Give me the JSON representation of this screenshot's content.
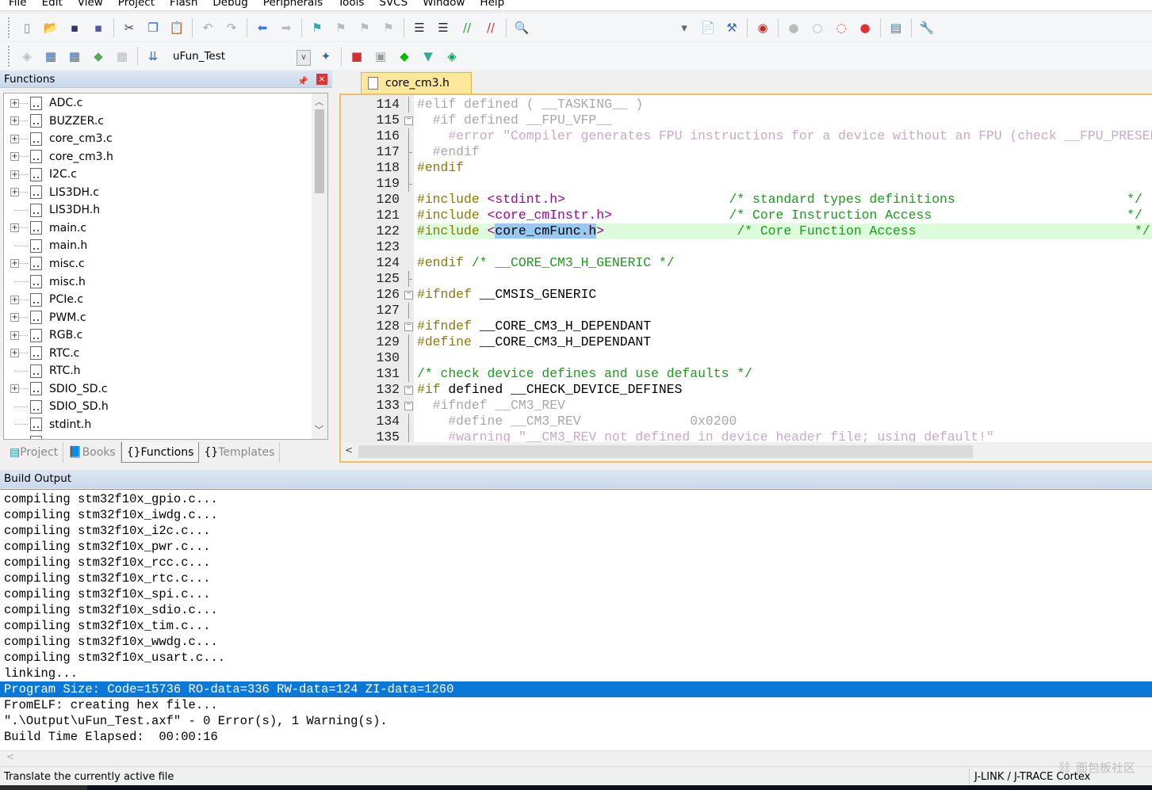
{
  "menu": [
    "File",
    "Edit",
    "View",
    "Project",
    "Flash",
    "Debug",
    "Peripherals",
    "Tools",
    "SVCS",
    "Window",
    "Help"
  ],
  "toolbar1": [
    "new-file",
    "open-file",
    "save",
    "save-all",
    "|",
    "cut",
    "copy",
    "paste",
    "|",
    "undo",
    "redo",
    "|",
    "navigate-back",
    "navigate-forward",
    "|",
    "bookmark",
    "prev-bookmark",
    "next-bookmark",
    "clear-bookmarks",
    "|",
    "indent",
    "unindent",
    "comment",
    "uncomment",
    "|",
    "find-in-files"
  ],
  "toolbar1_right": [
    "find-dropdown",
    "incremental-find",
    "find-references",
    "|",
    "debug-session",
    "|",
    "breakpoint",
    "breakpoint-disabled",
    "disable-all-breakpoints",
    "kill-all-breakpoints",
    "|",
    "window-layout",
    "|",
    "configure"
  ],
  "toolbar2": [
    "translate",
    "build",
    "rebuild",
    "batch-build",
    "stop-build",
    "|",
    "download"
  ],
  "target": "uFun_Test",
  "toolbar2_right": [
    "target-options",
    "|",
    "manage-components",
    "select-packs",
    "pack-installer",
    "event-recorder",
    "run-time-environment"
  ],
  "left_panel": {
    "title": "Functions",
    "pin": "pin-icon",
    "close": "×",
    "items": [
      {
        "label": "ADC.c",
        "expand": true
      },
      {
        "label": "BUZZER.c",
        "expand": true
      },
      {
        "label": "core_cm3.c",
        "expand": true
      },
      {
        "label": "core_cm3.h",
        "expand": true
      },
      {
        "label": "I2C.c",
        "expand": true
      },
      {
        "label": "LIS3DH.c",
        "expand": true
      },
      {
        "label": "LIS3DH.h",
        "expand": false
      },
      {
        "label": "main.c",
        "expand": true
      },
      {
        "label": "main.h",
        "expand": false
      },
      {
        "label": "misc.c",
        "expand": true
      },
      {
        "label": "misc.h",
        "expand": false
      },
      {
        "label": "PCIe.c",
        "expand": true
      },
      {
        "label": "PWM.c",
        "expand": true
      },
      {
        "label": "RGB.c",
        "expand": true
      },
      {
        "label": "RTC.c",
        "expand": true
      },
      {
        "label": "RTC.h",
        "expand": false
      },
      {
        "label": "SDIO_SD.c",
        "expand": true
      },
      {
        "label": "SDIO_SD.h",
        "expand": false
      },
      {
        "label": "stdint.h",
        "expand": false
      }
    ],
    "tabs": [
      {
        "label": "Project",
        "active": false
      },
      {
        "label": "Books",
        "active": false
      },
      {
        "label": "Functions",
        "active": true
      },
      {
        "label": "Templates",
        "active": false
      }
    ]
  },
  "editor": {
    "tab": "core_cm3.h",
    "highlight_line": 122,
    "lines": [
      {
        "n": "114",
        "fold": "line",
        "seg": [
          [
            "#elif defined ( __TASKING__ )",
            "in"
          ]
        ]
      },
      {
        "n": "115",
        "fold": "box",
        "seg": [
          [
            "  #if defined __FPU_VFP__",
            "in"
          ]
        ]
      },
      {
        "n": "116",
        "fold": "line",
        "seg": [
          [
            "    #error \"Compiler generates FPU instructions for a device without an FPU (check __FPU_PRESENT)\"",
            "ins"
          ]
        ]
      },
      {
        "n": "117",
        "fold": "tick",
        "seg": [
          [
            "  #endif",
            "in"
          ]
        ]
      },
      {
        "n": "118",
        "fold": "line",
        "seg": [
          [
            "#endif",
            "pp"
          ]
        ]
      },
      {
        "n": "119",
        "fold": "tick",
        "seg": []
      },
      {
        "n": "120",
        "fold": "",
        "seg": [
          [
            "#include ",
            "pp"
          ],
          [
            "<stdint.h>",
            "str"
          ],
          [
            "                     ",
            "id"
          ],
          [
            "/* standard types definitions                      */",
            "cm"
          ]
        ]
      },
      {
        "n": "121",
        "fold": "",
        "seg": [
          [
            "#include ",
            "pp"
          ],
          [
            "<core_cmInstr.h>",
            "str"
          ],
          [
            "               ",
            "id"
          ],
          [
            "/* Core Instruction Access                         */",
            "cm"
          ]
        ]
      },
      {
        "n": "122",
        "fold": "",
        "seg": [
          [
            "#include ",
            "pp"
          ],
          [
            "<",
            "str"
          ],
          [
            "core_cmFunc.h",
            "sel"
          ],
          [
            ">",
            "str"
          ],
          [
            "                 ",
            "id"
          ],
          [
            "/* Core Function Access                            */",
            "cm"
          ]
        ]
      },
      {
        "n": "123",
        "fold": "",
        "seg": []
      },
      {
        "n": "124",
        "fold": "",
        "seg": [
          [
            "#endif ",
            "pp"
          ],
          [
            "/* __CORE_CM3_H_GENERIC */",
            "cm"
          ]
        ]
      },
      {
        "n": "125",
        "fold": "tick",
        "seg": []
      },
      {
        "n": "126",
        "fold": "box",
        "seg": [
          [
            "#ifndef ",
            "pp"
          ],
          [
            "__CMSIS_GENERIC",
            "id"
          ]
        ]
      },
      {
        "n": "127",
        "fold": "line",
        "seg": []
      },
      {
        "n": "128",
        "fold": "box",
        "seg": [
          [
            "#ifndef ",
            "pp"
          ],
          [
            "__CORE_CM3_H_DEPENDANT",
            "id"
          ]
        ]
      },
      {
        "n": "129",
        "fold": "line",
        "seg": [
          [
            "#define ",
            "pp"
          ],
          [
            "__CORE_CM3_H_DEPENDANT",
            "id"
          ]
        ]
      },
      {
        "n": "130",
        "fold": "line",
        "seg": []
      },
      {
        "n": "131",
        "fold": "line",
        "seg": [
          [
            "/* check device defines and use defaults */",
            "cm"
          ]
        ]
      },
      {
        "n": "132",
        "fold": "box",
        "seg": [
          [
            "#if ",
            "pp"
          ],
          [
            "defined __CHECK_DEVICE_DEFINES",
            "id"
          ]
        ]
      },
      {
        "n": "133",
        "fold": "box",
        "seg": [
          [
            "  #ifndef __CM3_REV",
            "in"
          ]
        ]
      },
      {
        "n": "134",
        "fold": "line",
        "seg": [
          [
            "    #define __CM3_REV              0x0200",
            "in"
          ]
        ]
      },
      {
        "n": "135",
        "fold": "line",
        "seg": [
          [
            "    #warning \"__CM3_REV not defined in device header file; using default!\"",
            "ins"
          ]
        ]
      }
    ]
  },
  "build_output": {
    "title": "Build Output",
    "selected_line": 12,
    "lines": [
      "compiling stm32f10x_gpio.c...",
      "compiling stm32f10x_iwdg.c...",
      "compiling stm32f10x_i2c.c...",
      "compiling stm32f10x_pwr.c...",
      "compiling stm32f10x_rcc.c...",
      "compiling stm32f10x_rtc.c...",
      "compiling stm32f10x_spi.c...",
      "compiling stm32f10x_sdio.c...",
      "compiling stm32f10x_tim.c...",
      "compiling stm32f10x_wwdg.c...",
      "compiling stm32f10x_usart.c...",
      "linking...",
      "Program Size: Code=15736 RO-data=336 RW-data=124 ZI-data=1260",
      "FromELF: creating hex file...",
      "\".\\Output\\uFun_Test.axf\" - 0 Error(s), 1 Warning(s).",
      "Build Time Elapsed:  00:00:16"
    ]
  },
  "status": {
    "text": "Translate the currently active file",
    "debugger": "J-LINK / J-TRACE Cortex"
  },
  "watermark": "面包板社区",
  "colors": {
    "selection": "#0a78d7",
    "highlight_line": "#dcfcdc",
    "tab_active": "#fce79a",
    "comment": "#1e9a1e",
    "preprocessor": "#8a7a00",
    "string": "#a000a0"
  }
}
